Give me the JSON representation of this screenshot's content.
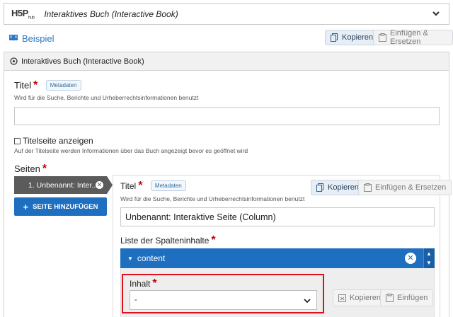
{
  "library_selector": {
    "logo": "H5P",
    "logo_sub": "hub",
    "title": "Interaktives Buch (Interactive Book)"
  },
  "content": {
    "title": "Beispiel",
    "copy_label": "Kopieren",
    "paste_replace_label": "Einfügen & Ersetzen"
  },
  "panel": {
    "heading": "Interaktives Buch (Interactive Book)",
    "title_label": "Titel",
    "metadata_label": "Metadaten",
    "title_description": "Wird für die Suche, Berichte und Urheberrechtsinformationen benutzt",
    "title_value": "",
    "cover_checkbox_label": "Titelseite anzeigen",
    "cover_description": "Auf der Titelseite werden Informationen über das Buch angezeigt bevor es geöffnet wird",
    "pages_label": "Seiten"
  },
  "pages": {
    "items": [
      {
        "label": "1. Unbenannt: Inter..."
      }
    ],
    "add_button_label": "SEITE HINZUFÜGEN"
  },
  "page_editor": {
    "title_label": "Titel",
    "metadata_label": "Metadaten",
    "copy_label": "Kopieren",
    "paste_replace_label": "Einfügen & Ersetzen",
    "title_description": "Wird für die Suche, Berichte und Urheberrechtsinformationen benutzt",
    "title_value": "Unbenannt: Interaktive Seite (Column)",
    "column_list_label": "Liste der Spalteninhalte",
    "content_item_label": "content",
    "inhalt_label": "Inhalt",
    "inhalt_select_value": "-",
    "inhalt_copy_label": "Kopieren",
    "inhalt_paste_label": "Einfügen"
  },
  "colors": {
    "accent_blue": "#1f6fc0",
    "required_red": "#cc0000",
    "highlight_red": "#e0101d"
  },
  "icons": [
    "chevron-down-icon",
    "book-icon",
    "copy-icon",
    "paste-icon",
    "library-icon",
    "close-icon",
    "plus-icon",
    "caret-down-icon",
    "arrow-up-icon",
    "arrow-down-icon"
  ]
}
